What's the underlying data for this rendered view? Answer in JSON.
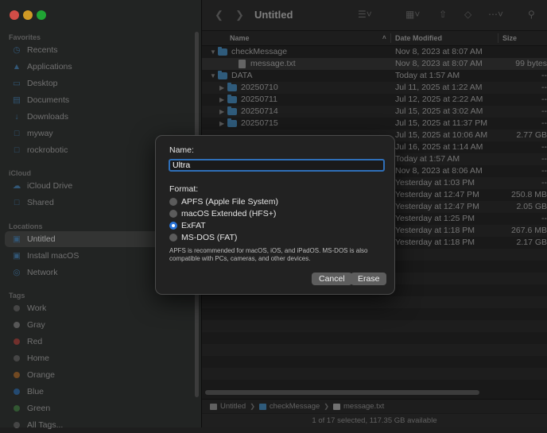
{
  "window": {
    "title": "Untitled"
  },
  "sidebar": {
    "sections": [
      {
        "heading": "Favorites",
        "items": [
          {
            "label": "Recents",
            "icon": "clock-icon"
          },
          {
            "label": "Applications",
            "icon": "applications-icon"
          },
          {
            "label": "Desktop",
            "icon": "desktop-icon"
          },
          {
            "label": "Documents",
            "icon": "document-icon"
          },
          {
            "label": "Downloads",
            "icon": "download-icon"
          },
          {
            "label": "myway",
            "icon": "folder-icon"
          },
          {
            "label": "rockrobotic",
            "icon": "folder-icon"
          }
        ]
      },
      {
        "heading": "iCloud",
        "items": [
          {
            "label": "iCloud Drive",
            "icon": "cloud-icon"
          },
          {
            "label": "Shared",
            "icon": "shared-folder-icon"
          }
        ]
      },
      {
        "heading": "Locations",
        "items": [
          {
            "label": "Untitled",
            "icon": "drive-icon",
            "selected": true
          },
          {
            "label": "Install macOS",
            "icon": "drive-icon"
          },
          {
            "label": "Network",
            "icon": "globe-icon"
          }
        ]
      },
      {
        "heading": "Tags",
        "items": [
          {
            "label": "Work",
            "tag_color": "#555555"
          },
          {
            "label": "Gray",
            "tag_color": "#6b6b6b"
          },
          {
            "label": "Red",
            "tag_color": "#8a3b36"
          },
          {
            "label": "Home",
            "tag_color": "#555555"
          },
          {
            "label": "Orange",
            "tag_color": "#8a5a2a"
          },
          {
            "label": "Blue",
            "tag_color": "#2d5b8a"
          },
          {
            "label": "Green",
            "tag_color": "#3d6b3d"
          },
          {
            "label": "All Tags...",
            "tag_color": "#555555"
          }
        ]
      }
    ]
  },
  "columns": {
    "name": "Name",
    "date": "Date Modified",
    "size": "Size"
  },
  "rows": [
    {
      "name": "checkMessage",
      "date": "Nov 8, 2023 at 8:07 AM",
      "size": "",
      "kind": "folder",
      "level": 0,
      "expanded": true
    },
    {
      "name": "message.txt",
      "date": "Nov 8, 2023 at 8:07 AM",
      "size": "99 bytes",
      "kind": "file",
      "level": 1,
      "selected": true
    },
    {
      "name": "DATA",
      "date": "Today at 1:57 AM",
      "size": "--",
      "kind": "folder",
      "level": 0,
      "expanded": true
    },
    {
      "name": "20250710",
      "date": "Jul 11, 2025 at 1:22 AM",
      "size": "--",
      "kind": "folder",
      "level": 1
    },
    {
      "name": "20250711",
      "date": "Jul 12, 2025 at 2:22 AM",
      "size": "--",
      "kind": "folder",
      "level": 1
    },
    {
      "name": "20250714",
      "date": "Jul 15, 2025 at 3:02 AM",
      "size": "--",
      "kind": "folder",
      "level": 1
    },
    {
      "name": "20250715",
      "date": "Jul 15, 2025 at 11:37 PM",
      "size": "--",
      "kind": "folder",
      "level": 1
    },
    {
      "name": "",
      "date": "Jul 15, 2025 at 10:06 AM",
      "size": "2.77 GB",
      "kind": "none",
      "level": 1
    },
    {
      "name": "",
      "date": "Jul 16, 2025 at 1:14 AM",
      "size": "--",
      "kind": "none",
      "level": 1
    },
    {
      "name": "",
      "date": "Today at 1:57 AM",
      "size": "--",
      "kind": "none",
      "level": 1
    },
    {
      "name": "",
      "date": "Nov 8, 2023 at 8:06 AM",
      "size": "--",
      "kind": "none",
      "level": 1
    },
    {
      "name": "",
      "date": "Yesterday at 1:03 PM",
      "size": "--",
      "kind": "none",
      "level": 1
    },
    {
      "name": "",
      "date": "Yesterday at 12:47 PM",
      "size": "250.8 MB",
      "kind": "none",
      "level": 1
    },
    {
      "name": "",
      "date": "Yesterday at 12:47 PM",
      "size": "2.05 GB",
      "kind": "none",
      "level": 1
    },
    {
      "name": "",
      "date": "Yesterday at 1:25 PM",
      "size": "--",
      "kind": "none",
      "level": 1
    },
    {
      "name": "",
      "date": "Yesterday at 1:18 PM",
      "size": "267.6 MB",
      "kind": "none",
      "level": 1
    },
    {
      "name": "",
      "date": "Yesterday at 1:18 PM",
      "size": "2.17 GB",
      "kind": "none",
      "level": 1
    }
  ],
  "pathbar": [
    {
      "label": "Untitled",
      "icon": "drive-icon"
    },
    {
      "label": "checkMessage",
      "icon": "folder-icon"
    },
    {
      "label": "message.txt",
      "icon": "document-icon"
    }
  ],
  "status": "1 of 17 selected, 117.35 GB available",
  "dialog": {
    "name_label": "Name:",
    "name_value": "Ultra",
    "format_label": "Format:",
    "formats": [
      {
        "label": "APFS (Apple File System)",
        "selected": false
      },
      {
        "label": "macOS Extended (HFS+)",
        "selected": false
      },
      {
        "label": "ExFAT",
        "selected": true
      },
      {
        "label": "MS-DOS (FAT)",
        "selected": false
      }
    ],
    "note": "APFS is recommended for macOS, iOS, and iPadOS. MS-DOS is also compatible with PCs, cameras, and other devices.",
    "cancel_label": "Cancel",
    "erase_label": "Erase"
  }
}
